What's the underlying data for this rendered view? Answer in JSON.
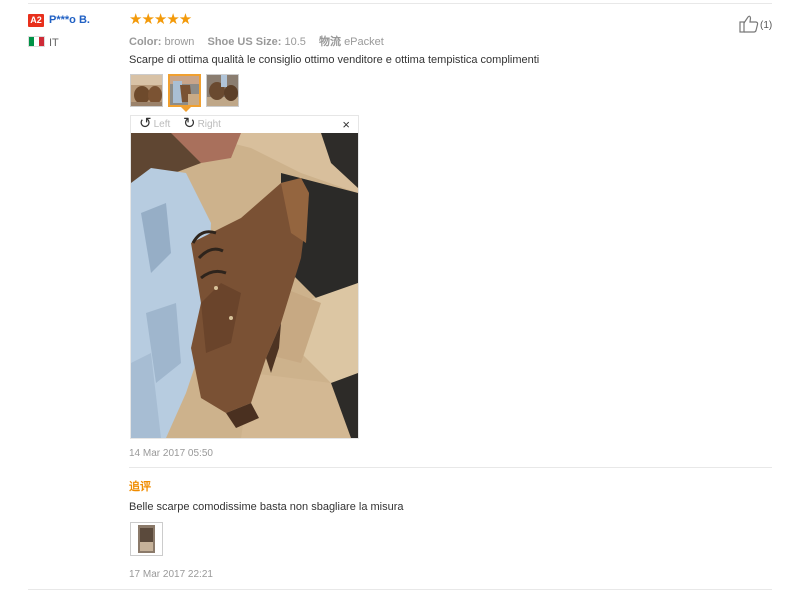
{
  "reviewer": {
    "level_badge": "A2",
    "name": "P***o B.",
    "country": "IT",
    "flag_colors": [
      "#009246",
      "#ffffff",
      "#ce2b37"
    ]
  },
  "review": {
    "rating": 5,
    "stars": "★★★★★",
    "attributes": [
      {
        "label": "Color:",
        "value": "brown"
      },
      {
        "label": "Shoe US Size:",
        "value": "10.5"
      },
      {
        "label": "物流",
        "value": "ePacket"
      }
    ],
    "text": "Scarpe di ottima qualità le consiglio ottimo venditore e ottima tempistica complimenti",
    "date": "14 Mar 2017 05:50",
    "like_count": "(1)"
  },
  "viewer": {
    "rotate_left_label": "Left",
    "rotate_right_label": "Right",
    "close_label": "×"
  },
  "followup": {
    "title": "追评",
    "text": "Belle scarpe comodissime basta non sbagliare la misura",
    "date": "17 Mar 2017 22:21"
  },
  "icons": [
    "thumbs-up-icon",
    "rotate-left-icon",
    "rotate-right-icon",
    "close-icon"
  ],
  "colors": {
    "star": "#f39a0a",
    "name": "#2161c4",
    "badge": "#e8301c",
    "followup_title": "#f08c00",
    "active_thumb_border": "#f0a030"
  }
}
